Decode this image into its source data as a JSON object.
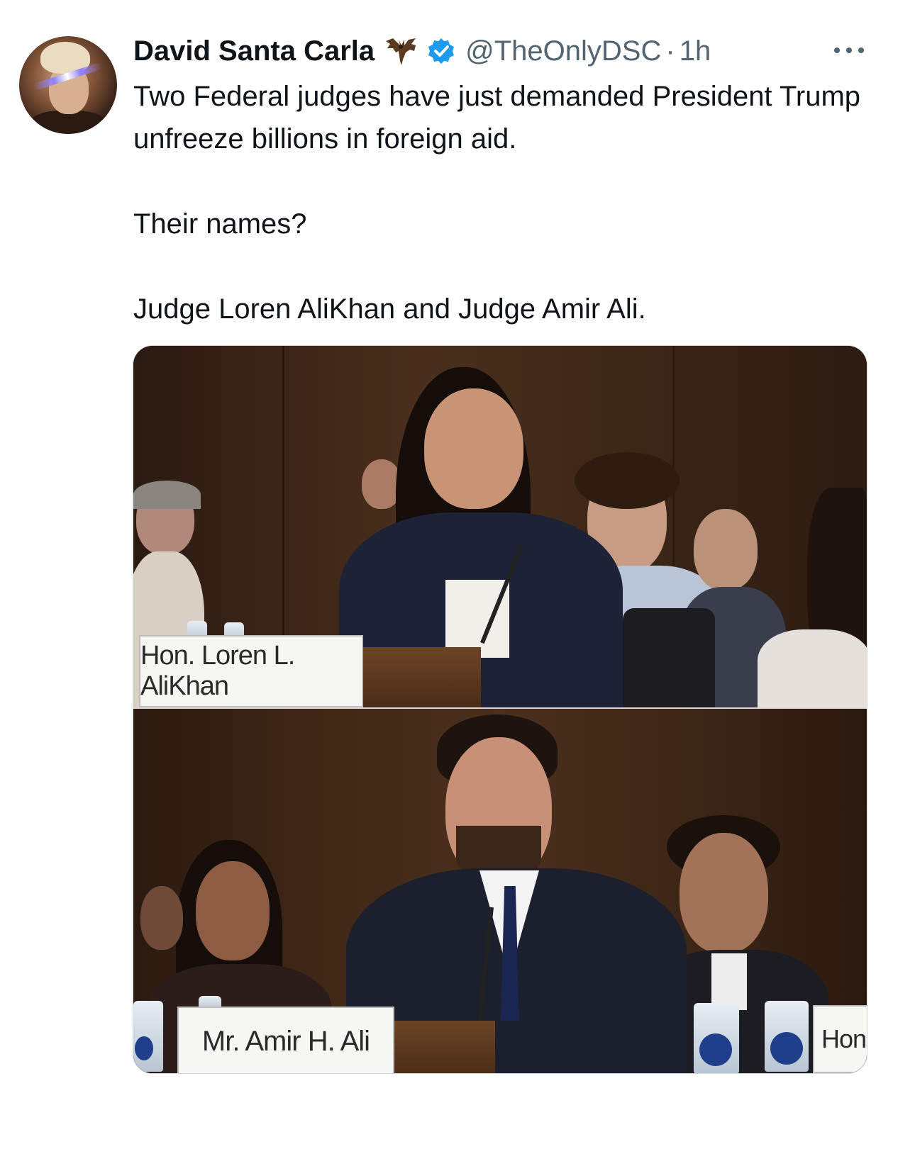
{
  "author": {
    "display_name": "David Santa Carla",
    "handle": "@TheOnlyDSC",
    "separator": "·",
    "time": "1h",
    "verified": true,
    "badge_icon": "bat-icon",
    "verified_icon": "verified-badge-icon"
  },
  "tweet": {
    "lines": [
      "Two Federal judges have just demanded President Trump unfreeze billions in foreign aid.",
      "Their names?",
      "Judge Loren AliKhan and Judge Amir Ali."
    ]
  },
  "media": {
    "top_nameplate": "Hon. Loren L. AliKhan",
    "bottom_nameplate": "Mr. Amir H. Ali",
    "bottom_right_nameplate": "Hon."
  },
  "colors": {
    "text": "#0f1419",
    "secondary": "#536471",
    "verified": "#1d9bf0"
  }
}
